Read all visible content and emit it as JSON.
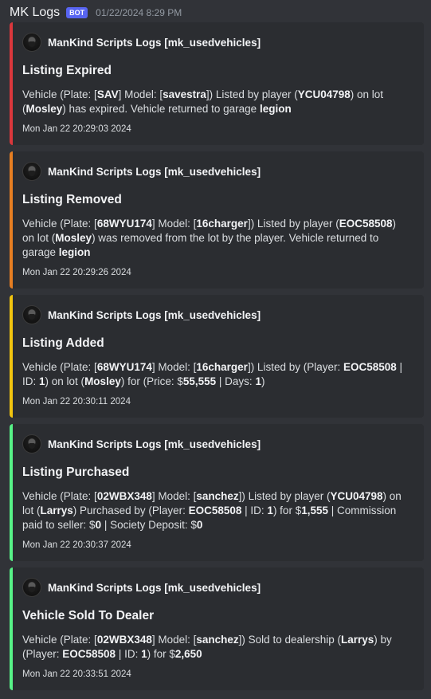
{
  "message": {
    "author": "MK Logs",
    "bot_tag": "BOT",
    "timestamp": "01/22/2024 8:29 PM"
  },
  "embeds": [
    {
      "color": "#da373c",
      "author": "ManKind Scripts Logs [mk_usedvehicles]",
      "title": "Listing Expired",
      "desc": [
        {
          "t": "Vehicle (Plate: ["
        },
        {
          "t": "SAV",
          "b": true
        },
        {
          "t": "] Model: ["
        },
        {
          "t": "savestra",
          "b": true
        },
        {
          "t": "]) Listed by player ("
        },
        {
          "t": "YCU04798",
          "b": true
        },
        {
          "t": ") on lot ("
        },
        {
          "t": "Mosley",
          "b": true
        },
        {
          "t": ") has expired. Vehicle returned to garage "
        },
        {
          "t": "legion",
          "b": true
        }
      ],
      "footer": "Mon Jan 22 20:29:03 2024"
    },
    {
      "color": "#e67e22",
      "author": "ManKind Scripts Logs [mk_usedvehicles]",
      "title": "Listing Removed",
      "desc": [
        {
          "t": "Vehicle (Plate: ["
        },
        {
          "t": "68WYU174",
          "b": true
        },
        {
          "t": "] Model: ["
        },
        {
          "t": "16charger",
          "b": true
        },
        {
          "t": "]) Listed by player ("
        },
        {
          "t": "EOC58508",
          "b": true
        },
        {
          "t": ") on lot ("
        },
        {
          "t": "Mosley",
          "b": true
        },
        {
          "t": ") was removed from the lot by the player. Vehicle returned to garage "
        },
        {
          "t": "legion",
          "b": true
        }
      ],
      "footer": "Mon Jan 22 20:29:26 2024"
    },
    {
      "color": "#f1c40f",
      "author": "ManKind Scripts Logs [mk_usedvehicles]",
      "title": "Listing Added",
      "desc": [
        {
          "t": "Vehicle (Plate: ["
        },
        {
          "t": "68WYU174",
          "b": true
        },
        {
          "t": "] Model: ["
        },
        {
          "t": "16charger",
          "b": true
        },
        {
          "t": "]) Listed by (Player: "
        },
        {
          "t": "EOC58508",
          "b": true
        },
        {
          "t": " | ID: "
        },
        {
          "t": "1",
          "b": true
        },
        {
          "t": ") on lot ("
        },
        {
          "t": "Mosley",
          "b": true
        },
        {
          "t": ") for (Price: $"
        },
        {
          "t": "55,555",
          "b": true
        },
        {
          "t": " | Days: "
        },
        {
          "t": "1",
          "b": true
        },
        {
          "t": ")"
        }
      ],
      "footer": "Mon Jan 22 20:30:11 2024"
    },
    {
      "color": "#57f287",
      "author": "ManKind Scripts Logs [mk_usedvehicles]",
      "title": "Listing Purchased",
      "desc": [
        {
          "t": "Vehicle (Plate: ["
        },
        {
          "t": "02WBX348",
          "b": true
        },
        {
          "t": "] Model: ["
        },
        {
          "t": "sanchez",
          "b": true
        },
        {
          "t": "]) Listed by player ("
        },
        {
          "t": "YCU04798",
          "b": true
        },
        {
          "t": ") on lot ("
        },
        {
          "t": "Larrys",
          "b": true
        },
        {
          "t": ") Purchased by (Player: "
        },
        {
          "t": "EOC58508",
          "b": true
        },
        {
          "t": " | ID: "
        },
        {
          "t": "1",
          "b": true
        },
        {
          "t": ") for $"
        },
        {
          "t": "1,555",
          "b": true
        },
        {
          "t": " | Commission paid to seller: $"
        },
        {
          "t": "0",
          "b": true
        },
        {
          "t": " | Society Deposit: $"
        },
        {
          "t": "0",
          "b": true
        }
      ],
      "footer": "Mon Jan 22 20:30:37 2024"
    },
    {
      "color": "#57f287",
      "author": "ManKind Scripts Logs [mk_usedvehicles]",
      "title": "Vehicle Sold To Dealer",
      "desc": [
        {
          "t": "Vehicle (Plate: ["
        },
        {
          "t": "02WBX348",
          "b": true
        },
        {
          "t": "] Model: ["
        },
        {
          "t": "sanchez",
          "b": true
        },
        {
          "t": "]) Sold to dealership ("
        },
        {
          "t": "Larrys",
          "b": true
        },
        {
          "t": ") by (Player: "
        },
        {
          "t": "EOC58508",
          "b": true
        },
        {
          "t": " | ID: "
        },
        {
          "t": "1",
          "b": true
        },
        {
          "t": ") for $"
        },
        {
          "t": "2,650",
          "b": true
        }
      ],
      "footer": "Mon Jan 22 20:33:51 2024"
    }
  ]
}
